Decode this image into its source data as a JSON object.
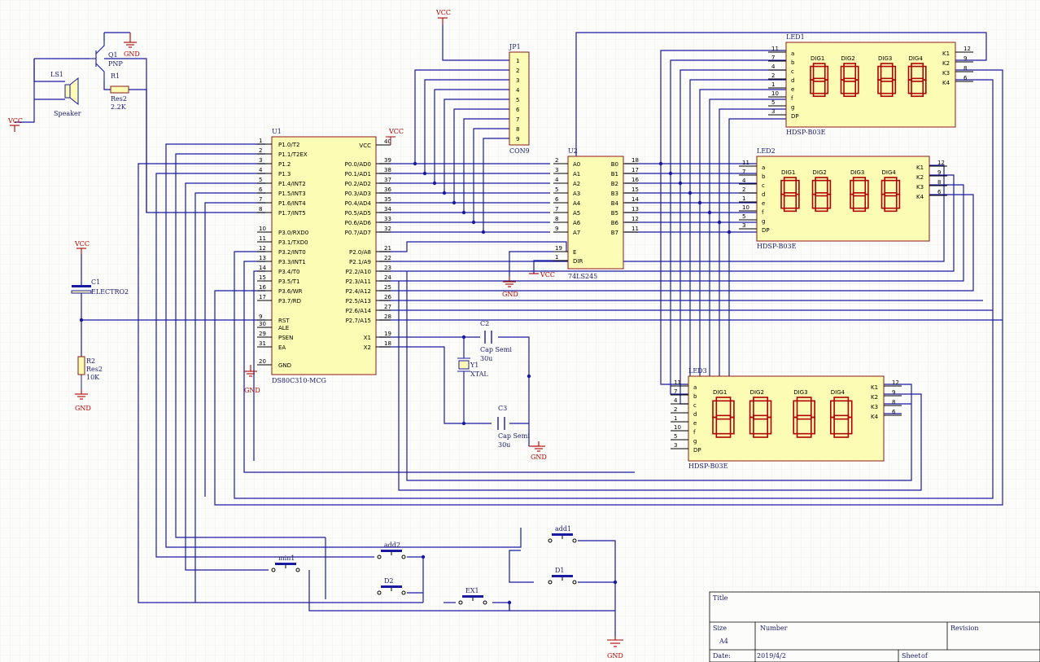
{
  "components": {
    "u1": {
      "ref": "U1",
      "part": "DS80C310-MCG",
      "vcc": "VCC",
      "left_pins": [
        {
          "num": "1",
          "name": "P1.0/T2"
        },
        {
          "num": "2",
          "name": "P1.1/T2EX"
        },
        {
          "num": "3",
          "name": "P1.2"
        },
        {
          "num": "4",
          "name": "P1.3"
        },
        {
          "num": "5",
          "name": "P1.4/INT2"
        },
        {
          "num": "6",
          "name": "P1.5/INT3"
        },
        {
          "num": "7",
          "name": "P1.6/INT4"
        },
        {
          "num": "8",
          "name": "P1.7/INT5"
        },
        {
          "num": "10",
          "name": "P3.0/RXD0"
        },
        {
          "num": "11",
          "name": "P3.1/TXD0"
        },
        {
          "num": "12",
          "name": "P3.2/INT0"
        },
        {
          "num": "13",
          "name": "P3.3/INT1"
        },
        {
          "num": "14",
          "name": "P3.4/T0"
        },
        {
          "num": "15",
          "name": "P3.5/T1"
        },
        {
          "num": "16",
          "name": "P3.6/WR"
        },
        {
          "num": "17",
          "name": "P3.7/RD"
        },
        {
          "num": "9",
          "name": "RST"
        },
        {
          "num": "30",
          "name": "ALE"
        },
        {
          "num": "29",
          "name": "PSEN"
        },
        {
          "num": "31",
          "name": "EA"
        },
        {
          "num": "20",
          "name": "GND"
        }
      ],
      "right_pins": [
        {
          "num": "40",
          "name": "VCC"
        },
        {
          "num": "39",
          "name": "P0.0/AD0"
        },
        {
          "num": "38",
          "name": "P0.1/AD1"
        },
        {
          "num": "37",
          "name": "P0.2/AD2"
        },
        {
          "num": "36",
          "name": "P0.3/AD3"
        },
        {
          "num": "35",
          "name": "P0.4/AD4"
        },
        {
          "num": "34",
          "name": "P0.5/AD5"
        },
        {
          "num": "33",
          "name": "P0.6/AD6"
        },
        {
          "num": "32",
          "name": "P0.7/AD7"
        },
        {
          "num": "21",
          "name": "P2.0/A8"
        },
        {
          "num": "22",
          "name": "P2.1/A9"
        },
        {
          "num": "23",
          "name": "P2.2/A10"
        },
        {
          "num": "24",
          "name": "P2.3/A11"
        },
        {
          "num": "25",
          "name": "P2.4/A12"
        },
        {
          "num": "26",
          "name": "P2.5/A13"
        },
        {
          "num": "27",
          "name": "P2.6/A14"
        },
        {
          "num": "28",
          "name": "P2.7/A15"
        },
        {
          "num": "19",
          "name": "X1"
        },
        {
          "num": "18",
          "name": "X2"
        }
      ]
    },
    "u2": {
      "ref": "U2",
      "part": "74LS245",
      "left_pins": [
        {
          "num": "2",
          "name": "A0"
        },
        {
          "num": "3",
          "name": "A1"
        },
        {
          "num": "4",
          "name": "A2"
        },
        {
          "num": "5",
          "name": "A3"
        },
        {
          "num": "6",
          "name": "A4"
        },
        {
          "num": "7",
          "name": "A5"
        },
        {
          "num": "8",
          "name": "A6"
        },
        {
          "num": "9",
          "name": "A7"
        },
        {
          "num": "19",
          "name": "E"
        },
        {
          "num": "1",
          "name": "DIR"
        }
      ],
      "right_pins": [
        {
          "num": "18",
          "name": "B0"
        },
        {
          "num": "17",
          "name": "B1"
        },
        {
          "num": "16",
          "name": "B2"
        },
        {
          "num": "15",
          "name": "B3"
        },
        {
          "num": "14",
          "name": "B4"
        },
        {
          "num": "13",
          "name": "B5"
        },
        {
          "num": "12",
          "name": "B6"
        },
        {
          "num": "11",
          "name": "B7"
        }
      ]
    },
    "jp1": {
      "ref": "JP1",
      "part": "CON9",
      "pins": [
        "1",
        "2",
        "3",
        "4",
        "5",
        "6",
        "7",
        "8",
        "9"
      ],
      "vcc": "VCC"
    },
    "leds": [
      {
        "ref": "LED1",
        "part": "HDSP-B03E"
      },
      {
        "ref": "LED2",
        "part": "HDSP-B03E"
      },
      {
        "ref": "LED3",
        "part": "HDSP-B03E"
      }
    ],
    "led_pins_left": [
      {
        "num": "11",
        "seg": "a"
      },
      {
        "num": "7",
        "seg": "b"
      },
      {
        "num": "4",
        "seg": "c"
      },
      {
        "num": "2",
        "seg": "d"
      },
      {
        "num": "1",
        "seg": "e"
      },
      {
        "num": "10",
        "seg": "f"
      },
      {
        "num": "5",
        "seg": "g"
      },
      {
        "num": "3",
        "seg": "DP"
      }
    ],
    "led_pins_right": [
      {
        "num": "12",
        "name": "K1"
      },
      {
        "num": "9",
        "name": "K2"
      },
      {
        "num": "8",
        "name": "K3"
      },
      {
        "num": "6",
        "name": "K4"
      }
    ],
    "digit_labels": [
      "DIG1",
      "DIG2",
      "DIG3",
      "DIG4"
    ],
    "q1": {
      "ref": "Q1",
      "type": "PNP"
    },
    "r1": {
      "ref": "R1",
      "part": "Res2",
      "value": "2.2K"
    },
    "ls1": {
      "ref": "LS1",
      "part": "Speaker"
    },
    "c1": {
      "ref": "C1",
      "part": "ELECTRO2"
    },
    "r2": {
      "ref": "R2",
      "part": "Res2",
      "value": "10K"
    },
    "c2": {
      "ref": "C2",
      "part": "Cap Semi",
      "value": "30u"
    },
    "c3": {
      "ref": "C3",
      "part": "Cap Semi",
      "value": "30u"
    },
    "y1": {
      "ref": "Y1",
      "part": "XTAL"
    },
    "buttons": {
      "add2": "add2",
      "add1": "add1",
      "min1": "min1",
      "d2": "D2",
      "d1": "D1",
      "ex1": "EX1"
    },
    "vcc_label": "VCC",
    "gnd_label": "GND"
  },
  "title_block": {
    "title_label": "Title",
    "size_label": "Size",
    "size_value": "A4",
    "number_label": "Number",
    "revision_label": "Revision",
    "date_label": "Date:",
    "date_value": "2019/4/2",
    "sheet_label": "Sheet",
    "of_label": "of"
  },
  "colors": {
    "wire": "#1a1aa0",
    "body": "#fdfcb4",
    "body_stroke": "#8b1a1a",
    "power": "#b00000",
    "seg": "#b00000",
    "grid": "#e6e6e0"
  }
}
